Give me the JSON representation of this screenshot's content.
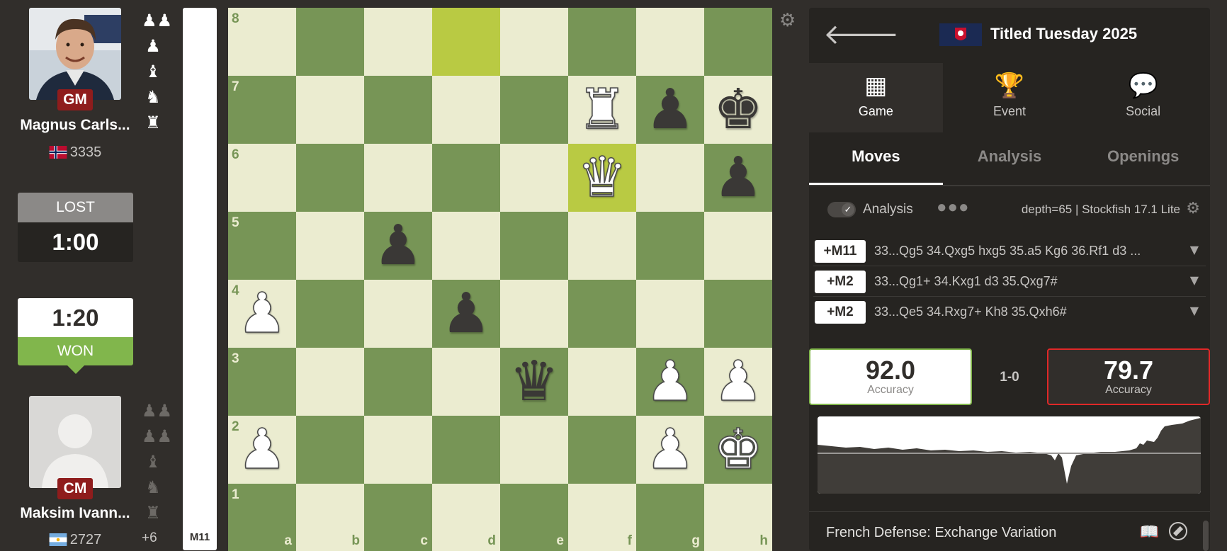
{
  "top_player": {
    "title": "GM",
    "name": "Magnus Carls...",
    "rating": "3335",
    "status": "LOST",
    "clock": "1:00",
    "captured": [
      "♟♟",
      "♟",
      "♝",
      "♞",
      "♜"
    ]
  },
  "bottom_player": {
    "title": "CM",
    "name": "Maksim Ivann...",
    "rating": "2727",
    "status": "WON",
    "clock": "1:20",
    "captured": [
      "♟♟",
      "♟♟",
      "♝",
      "♞",
      "♜"
    ],
    "material_diff": "+6"
  },
  "eval_bar": {
    "label": "M11"
  },
  "board": {
    "ranks": [
      "8",
      "7",
      "6",
      "5",
      "4",
      "3",
      "2",
      "1"
    ],
    "files": [
      "a",
      "b",
      "c",
      "d",
      "e",
      "f",
      "g",
      "h"
    ],
    "highlighted_squares": [
      "d8",
      "f6"
    ],
    "pieces": {
      "f7": {
        "glyph": "♜",
        "color": "w"
      },
      "g7": {
        "glyph": "♟",
        "color": "b"
      },
      "h7": {
        "glyph": "♚",
        "color": "b"
      },
      "f6": {
        "glyph": "♛",
        "color": "w"
      },
      "h6": {
        "glyph": "♟",
        "color": "b"
      },
      "c5": {
        "glyph": "♟",
        "color": "b"
      },
      "a4": {
        "glyph": "♟",
        "color": "w"
      },
      "d4": {
        "glyph": "♟",
        "color": "b"
      },
      "e3": {
        "glyph": "♛",
        "color": "b"
      },
      "g3": {
        "glyph": "♟",
        "color": "w"
      },
      "h3": {
        "glyph": "♟",
        "color": "w"
      },
      "a2": {
        "glyph": "♟",
        "color": "w"
      },
      "g2": {
        "glyph": "♟",
        "color": "w"
      },
      "h2": {
        "glyph": "♚",
        "color": "w"
      }
    },
    "colors": {
      "light": "#ebecd0",
      "dark": "#779556",
      "highlight": "#b9ca43"
    }
  },
  "header": {
    "event_title": "Titled Tuesday 2025"
  },
  "top_tabs": [
    {
      "label": "Game",
      "icon": "checkered-board-icon",
      "glyph": "▦"
    },
    {
      "label": "Event",
      "icon": "trophy-icon",
      "glyph": "🏆"
    },
    {
      "label": "Social",
      "icon": "chat-bubbles-icon",
      "glyph": "💬"
    }
  ],
  "sub_tabs": [
    "Moves",
    "Analysis",
    "Openings"
  ],
  "analysis": {
    "label": "Analysis",
    "engine": "depth=65 | Stockfish 17.1 Lite",
    "lines": [
      {
        "eval": "+M11",
        "moves": "33...Qg5 34.Qxg5 hxg5 35.a5 Kg6 36.Rf1 d3 ..."
      },
      {
        "eval": "+M2",
        "moves": "33...Qg1+ 34.Kxg1 d3 35.Qxg7#"
      },
      {
        "eval": "+M2",
        "moves": "33...Qe5 34.Rxg7+ Kh8 35.Qxh6#"
      }
    ]
  },
  "accuracy": {
    "white": "92.0",
    "black": "79.7",
    "label": "Accuracy",
    "result": "1-0"
  },
  "opening": {
    "name": "French Defense: Exchange Variation"
  }
}
